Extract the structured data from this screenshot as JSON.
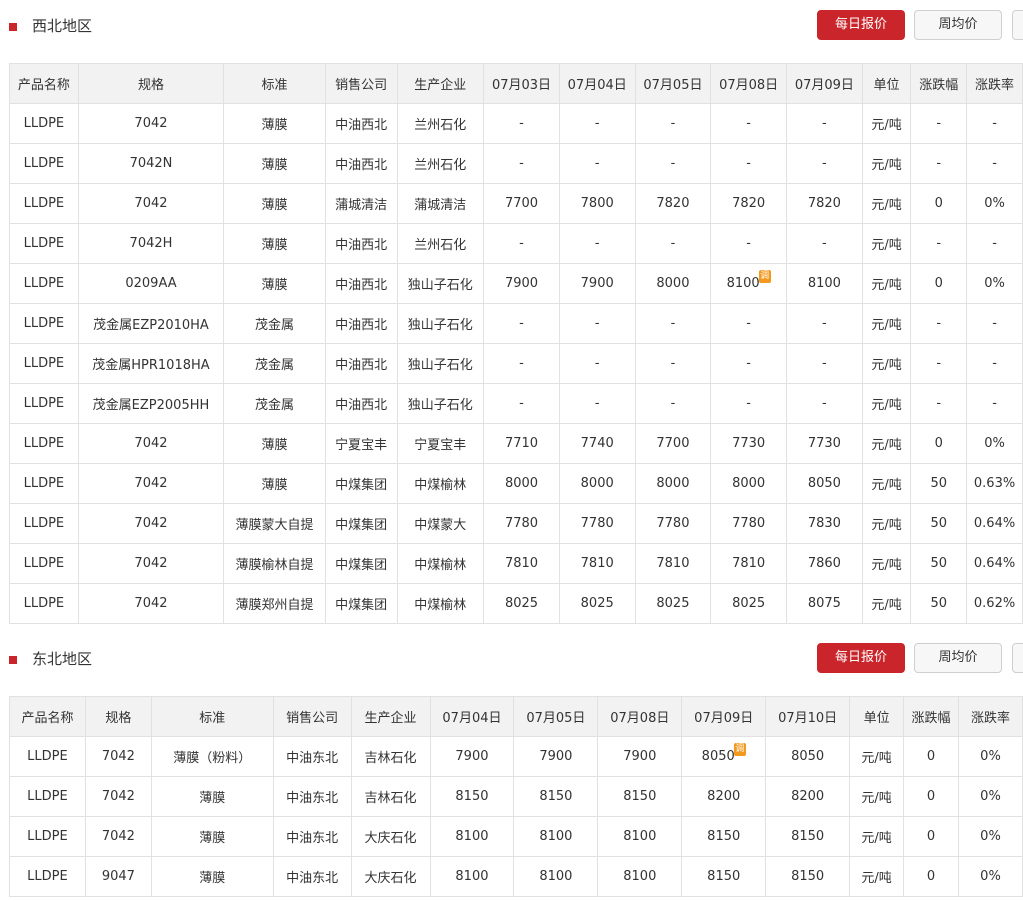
{
  "sections": [
    {
      "title": "西北地区",
      "buttons": {
        "daily": "每日报价",
        "weekly": "周均价"
      },
      "headers": [
        "产品名称",
        "规格",
        "标准",
        "销售公司",
        "生产企业",
        "07月03日",
        "07月04日",
        "07月05日",
        "07月08日",
        "07月09日",
        "单位",
        "涨跌幅",
        "涨跌率"
      ],
      "rows": [
        [
          "LLDPE",
          "7042",
          "薄膜",
          "中油西北",
          "兰州石化",
          "-",
          "-",
          "-",
          "-",
          "-",
          "元/吨",
          "-",
          "-"
        ],
        [
          "LLDPE",
          "7042N",
          "薄膜",
          "中油西北",
          "兰州石化",
          "-",
          "-",
          "-",
          "-",
          "-",
          "元/吨",
          "-",
          "-"
        ],
        [
          "LLDPE",
          "7042",
          "薄膜",
          "蒲城清洁",
          "蒲城清洁",
          "7700",
          "7800",
          "7820",
          "7820",
          "7820",
          "元/吨",
          "0",
          "0%"
        ],
        [
          "LLDPE",
          "7042H",
          "薄膜",
          "中油西北",
          "兰州石化",
          "-",
          "-",
          "-",
          "-",
          "-",
          "元/吨",
          "-",
          "-"
        ],
        [
          "LLDPE",
          "0209AA",
          "薄膜",
          "中油西北",
          "独山子石化",
          "7900",
          "7900",
          "8000",
          "8100",
          "8100",
          "元/吨",
          "0",
          "0%"
        ],
        [
          "LLDPE",
          "茂金属EZP2010HA",
          "茂金属",
          "中油西北",
          "独山子石化",
          "-",
          "-",
          "-",
          "-",
          "-",
          "元/吨",
          "-",
          "-"
        ],
        [
          "LLDPE",
          "茂金属HPR1018HA",
          "茂金属",
          "中油西北",
          "独山子石化",
          "-",
          "-",
          "-",
          "-",
          "-",
          "元/吨",
          "-",
          "-"
        ],
        [
          "LLDPE",
          "茂金属EZP2005HH",
          "茂金属",
          "中油西北",
          "独山子石化",
          "-",
          "-",
          "-",
          "-",
          "-",
          "元/吨",
          "-",
          "-"
        ],
        [
          "LLDPE",
          "7042",
          "薄膜",
          "宁夏宝丰",
          "宁夏宝丰",
          "7710",
          "7740",
          "7700",
          "7730",
          "7730",
          "元/吨",
          "0",
          "0%"
        ],
        [
          "LLDPE",
          "7042",
          "薄膜",
          "中煤集团",
          "中煤榆林",
          "8000",
          "8000",
          "8000",
          "8000",
          "8050",
          "元/吨",
          "50",
          "0.63%"
        ],
        [
          "LLDPE",
          "7042",
          "薄膜蒙大自提",
          "中煤集团",
          "中煤蒙大",
          "7780",
          "7780",
          "7780",
          "7780",
          "7830",
          "元/吨",
          "50",
          "0.64%"
        ],
        [
          "LLDPE",
          "7042",
          "薄膜榆林自提",
          "中煤集团",
          "中煤榆林",
          "7810",
          "7810",
          "7810",
          "7810",
          "7860",
          "元/吨",
          "50",
          "0.64%"
        ],
        [
          "LLDPE",
          "7042",
          "薄膜郑州自提",
          "中煤集团",
          "中煤榆林",
          "8025",
          "8025",
          "8025",
          "8025",
          "8075",
          "元/吨",
          "50",
          "0.62%"
        ]
      ],
      "styles": [
        [
          "",
          "",
          "",
          "",
          "",
          "",
          "",
          "",
          "",
          "",
          "",
          "",
          ""
        ],
        [
          "",
          "",
          "",
          "",
          "",
          "",
          "",
          "",
          "",
          "",
          "",
          "",
          ""
        ],
        [
          "",
          "",
          "",
          "",
          "",
          "up",
          "up",
          "up",
          "",
          "",
          "",
          "",
          ""
        ],
        [
          "",
          "",
          "",
          "",
          "",
          "",
          "",
          "",
          "",
          "",
          "",
          "",
          ""
        ],
        [
          "",
          "",
          "",
          "",
          "",
          "",
          "",
          "up",
          "tiao",
          "",
          "",
          "",
          ""
        ],
        [
          "",
          "",
          "",
          "",
          "",
          "",
          "",
          "",
          "",
          "",
          "",
          "",
          ""
        ],
        [
          "",
          "",
          "",
          "",
          "",
          "",
          "",
          "",
          "",
          "",
          "",
          "",
          ""
        ],
        [
          "",
          "",
          "",
          "",
          "",
          "",
          "",
          "",
          "",
          "",
          "",
          "",
          ""
        ],
        [
          "",
          "",
          "",
          "",
          "",
          "up",
          "up",
          "down",
          "up",
          "",
          "",
          "",
          ""
        ],
        [
          "",
          "",
          "",
          "",
          "",
          "up",
          "",
          "",
          "",
          "up",
          "",
          "up",
          "up"
        ],
        [
          "",
          "",
          "",
          "",
          "",
          "up",
          "",
          "",
          "",
          "up",
          "",
          "up",
          "up"
        ],
        [
          "",
          "",
          "",
          "",
          "",
          "up",
          "",
          "",
          "",
          "up",
          "",
          "up",
          "up"
        ],
        [
          "",
          "",
          "",
          "",
          "",
          "up",
          "",
          "",
          "",
          "up",
          "",
          "up",
          "up"
        ]
      ]
    },
    {
      "title": "东北地区",
      "buttons": {
        "daily": "每日报价",
        "weekly": "周均价"
      },
      "headers": [
        "产品名称",
        "规格",
        "标准",
        "销售公司",
        "生产企业",
        "07月04日",
        "07月05日",
        "07月08日",
        "07月09日",
        "07月10日",
        "单位",
        "涨跌幅",
        "涨跌率"
      ],
      "rows": [
        [
          "LLDPE",
          "7042",
          "薄膜（粉料）",
          "中油东北",
          "吉林石化",
          "7900",
          "7900",
          "7900",
          "8050",
          "8050",
          "元/吨",
          "0",
          "0%"
        ],
        [
          "LLDPE",
          "7042",
          "薄膜",
          "中油东北",
          "吉林石化",
          "8150",
          "8150",
          "8150",
          "8200",
          "8200",
          "元/吨",
          "0",
          "0%"
        ],
        [
          "LLDPE",
          "7042",
          "薄膜",
          "中油东北",
          "大庆石化",
          "8100",
          "8100",
          "8100",
          "8150",
          "8150",
          "元/吨",
          "0",
          "0%"
        ],
        [
          "LLDPE",
          "9047",
          "薄膜",
          "中油东北",
          "大庆石化",
          "8100",
          "8100",
          "8100",
          "8150",
          "8150",
          "元/吨",
          "0",
          "0%"
        ]
      ],
      "styles": [
        [
          "",
          "",
          "",
          "",
          "",
          "",
          "",
          "",
          "tiao",
          "",
          "",
          "",
          ""
        ],
        [
          "",
          "",
          "",
          "",
          "",
          "",
          "",
          "",
          "up",
          "",
          "",
          "",
          ""
        ],
        [
          "",
          "",
          "",
          "",
          "",
          "",
          "",
          "",
          "up",
          "",
          "",
          "",
          ""
        ],
        [
          "",
          "",
          "",
          "",
          "",
          "",
          "",
          "",
          "up",
          "",
          "",
          "",
          ""
        ]
      ]
    }
  ],
  "adjust_mark": "调"
}
